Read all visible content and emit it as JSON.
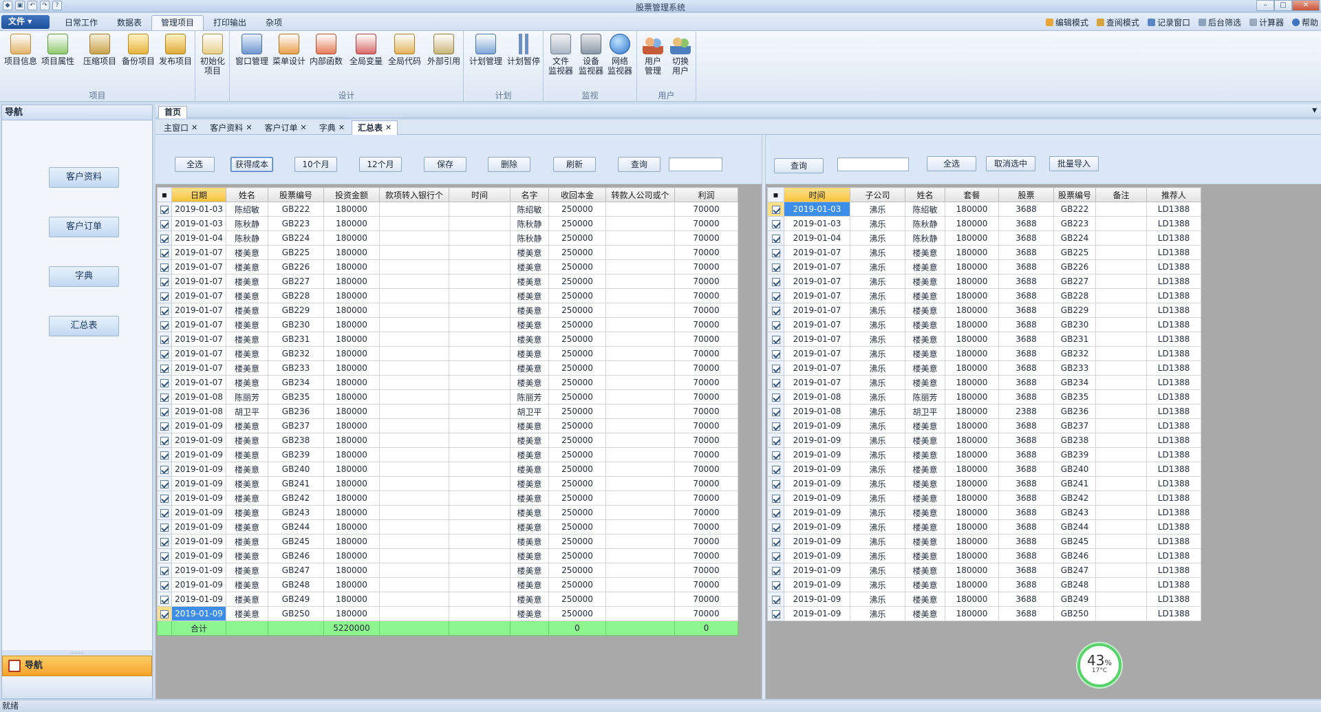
{
  "window": {
    "title": "股票管理系统"
  },
  "menu": {
    "file": "文件",
    "tabs": [
      "日常工作",
      "数据表",
      "管理项目",
      "打印输出",
      "杂项"
    ],
    "right": [
      "编辑模式",
      "查阅模式",
      "记录窗口",
      "后台筛选",
      "计算器",
      "帮助"
    ]
  },
  "ribbon": {
    "groups": [
      {
        "name": "项目",
        "buttons": [
          "项目信息",
          "项目属性",
          "压缩项目",
          "备份项目",
          "发布项目",
          "初始化\n项目"
        ]
      },
      {
        "name": "设计",
        "buttons": [
          "窗口管理",
          "菜单设计",
          "内部函数",
          "全局变量",
          "全局代码",
          "外部引用"
        ]
      },
      {
        "name": "计划",
        "buttons": [
          "计划管理",
          "计划暂停"
        ]
      },
      {
        "name": "监视",
        "buttons": [
          "文件\n监视器",
          "设备\n监视器",
          "网络\n监视器"
        ]
      },
      {
        "name": "用户",
        "buttons": [
          "用户\n管理",
          "切换\n用户"
        ]
      }
    ]
  },
  "nav": {
    "title": "导航",
    "items": [
      "客户资料",
      "客户订单",
      "字典",
      "汇总表"
    ],
    "footer": "导航",
    "grip": "........"
  },
  "doc": {
    "home": "首页",
    "tabs": [
      "主窗口",
      "客户资料",
      "客户订单",
      "字典",
      "汇总表"
    ],
    "active_tab": "汇总表"
  },
  "left_toolbar": {
    "buttons": [
      "全选",
      "获得成本",
      "10个月",
      "12个月",
      "保存",
      "删除",
      "刷新",
      "查询"
    ],
    "search_value": ""
  },
  "right_toolbar": {
    "buttons": [
      "查询",
      "全选",
      "取消选中",
      "批量导入"
    ],
    "search_value": ""
  },
  "left_table": {
    "headers": [
      "日期",
      "姓名",
      "股票编号",
      "投资金额",
      "款项转入银行个",
      "时间",
      "名字",
      "收回本金",
      "转款人公司或个",
      "利润"
    ],
    "rows": [
      [
        "2019-01-03",
        "陈绍敏",
        "GB222",
        "180000",
        "",
        "",
        "陈绍敏",
        "250000",
        "",
        "70000"
      ],
      [
        "2019-01-03",
        "陈秋静",
        "GB223",
        "180000",
        "",
        "",
        "陈秋静",
        "250000",
        "",
        "70000"
      ],
      [
        "2019-01-04",
        "陈秋静",
        "GB224",
        "180000",
        "",
        "",
        "陈秋静",
        "250000",
        "",
        "70000"
      ],
      [
        "2019-01-07",
        "楼美意",
        "GB225",
        "180000",
        "",
        "",
        "楼美意",
        "250000",
        "",
        "70000"
      ],
      [
        "2019-01-07",
        "楼美意",
        "GB226",
        "180000",
        "",
        "",
        "楼美意",
        "250000",
        "",
        "70000"
      ],
      [
        "2019-01-07",
        "楼美意",
        "GB227",
        "180000",
        "",
        "",
        "楼美意",
        "250000",
        "",
        "70000"
      ],
      [
        "2019-01-07",
        "楼美意",
        "GB228",
        "180000",
        "",
        "",
        "楼美意",
        "250000",
        "",
        "70000"
      ],
      [
        "2019-01-07",
        "楼美意",
        "GB229",
        "180000",
        "",
        "",
        "楼美意",
        "250000",
        "",
        "70000"
      ],
      [
        "2019-01-07",
        "楼美意",
        "GB230",
        "180000",
        "",
        "",
        "楼美意",
        "250000",
        "",
        "70000"
      ],
      [
        "2019-01-07",
        "楼美意",
        "GB231",
        "180000",
        "",
        "",
        "楼美意",
        "250000",
        "",
        "70000"
      ],
      [
        "2019-01-07",
        "楼美意",
        "GB232",
        "180000",
        "",
        "",
        "楼美意",
        "250000",
        "",
        "70000"
      ],
      [
        "2019-01-07",
        "楼美意",
        "GB233",
        "180000",
        "",
        "",
        "楼美意",
        "250000",
        "",
        "70000"
      ],
      [
        "2019-01-07",
        "楼美意",
        "GB234",
        "180000",
        "",
        "",
        "楼美意",
        "250000",
        "",
        "70000"
      ],
      [
        "2019-01-08",
        "陈丽芳",
        "GB235",
        "180000",
        "",
        "",
        "陈丽芳",
        "250000",
        "",
        "70000"
      ],
      [
        "2019-01-08",
        "胡卫平",
        "GB236",
        "180000",
        "",
        "",
        "胡卫平",
        "250000",
        "",
        "70000"
      ],
      [
        "2019-01-09",
        "楼美意",
        "GB237",
        "180000",
        "",
        "",
        "楼美意",
        "250000",
        "",
        "70000"
      ],
      [
        "2019-01-09",
        "楼美意",
        "GB238",
        "180000",
        "",
        "",
        "楼美意",
        "250000",
        "",
        "70000"
      ],
      [
        "2019-01-09",
        "楼美意",
        "GB239",
        "180000",
        "",
        "",
        "楼美意",
        "250000",
        "",
        "70000"
      ],
      [
        "2019-01-09",
        "楼美意",
        "GB240",
        "180000",
        "",
        "",
        "楼美意",
        "250000",
        "",
        "70000"
      ],
      [
        "2019-01-09",
        "楼美意",
        "GB241",
        "180000",
        "",
        "",
        "楼美意",
        "250000",
        "",
        "70000"
      ],
      [
        "2019-01-09",
        "楼美意",
        "GB242",
        "180000",
        "",
        "",
        "楼美意",
        "250000",
        "",
        "70000"
      ],
      [
        "2019-01-09",
        "楼美意",
        "GB243",
        "180000",
        "",
        "",
        "楼美意",
        "250000",
        "",
        "70000"
      ],
      [
        "2019-01-09",
        "楼美意",
        "GB244",
        "180000",
        "",
        "",
        "楼美意",
        "250000",
        "",
        "70000"
      ],
      [
        "2019-01-09",
        "楼美意",
        "GB245",
        "180000",
        "",
        "",
        "楼美意",
        "250000",
        "",
        "70000"
      ],
      [
        "2019-01-09",
        "楼美意",
        "GB246",
        "180000",
        "",
        "",
        "楼美意",
        "250000",
        "",
        "70000"
      ],
      [
        "2019-01-09",
        "楼美意",
        "GB247",
        "180000",
        "",
        "",
        "楼美意",
        "250000",
        "",
        "70000"
      ],
      [
        "2019-01-09",
        "楼美意",
        "GB248",
        "180000",
        "",
        "",
        "楼美意",
        "250000",
        "",
        "70000"
      ],
      [
        "2019-01-09",
        "楼美意",
        "GB249",
        "180000",
        "",
        "",
        "楼美意",
        "250000",
        "",
        "70000"
      ],
      [
        "2019-01-09",
        "楼美意",
        "GB250",
        "180000",
        "",
        "",
        "楼美意",
        "250000",
        "",
        "70000"
      ]
    ],
    "total": [
      "合计",
      "",
      "",
      "5220000",
      "",
      "",
      "",
      "0",
      "",
      "0"
    ]
  },
  "right_table": {
    "headers": [
      "时间",
      "子公司",
      "姓名",
      "套餐",
      "股票",
      "股票编号",
      "备注",
      "推荐人"
    ],
    "rows": [
      [
        "2019-01-03",
        "沸乐",
        "陈绍敏",
        "180000",
        "3688",
        "GB222",
        "",
        "LD1388"
      ],
      [
        "2019-01-03",
        "沸乐",
        "陈秋静",
        "180000",
        "3688",
        "GB223",
        "",
        "LD1388"
      ],
      [
        "2019-01-04",
        "沸乐",
        "陈秋静",
        "180000",
        "3688",
        "GB224",
        "",
        "LD1388"
      ],
      [
        "2019-01-07",
        "沸乐",
        "楼美意",
        "180000",
        "3688",
        "GB225",
        "",
        "LD1388"
      ],
      [
        "2019-01-07",
        "沸乐",
        "楼美意",
        "180000",
        "3688",
        "GB226",
        "",
        "LD1388"
      ],
      [
        "2019-01-07",
        "沸乐",
        "楼美意",
        "180000",
        "3688",
        "GB227",
        "",
        "LD1388"
      ],
      [
        "2019-01-07",
        "沸乐",
        "楼美意",
        "180000",
        "3688",
        "GB228",
        "",
        "LD1388"
      ],
      [
        "2019-01-07",
        "沸乐",
        "楼美意",
        "180000",
        "3688",
        "GB229",
        "",
        "LD1388"
      ],
      [
        "2019-01-07",
        "沸乐",
        "楼美意",
        "180000",
        "3688",
        "GB230",
        "",
        "LD1388"
      ],
      [
        "2019-01-07",
        "沸乐",
        "楼美意",
        "180000",
        "3688",
        "GB231",
        "",
        "LD1388"
      ],
      [
        "2019-01-07",
        "沸乐",
        "楼美意",
        "180000",
        "3688",
        "GB232",
        "",
        "LD1388"
      ],
      [
        "2019-01-07",
        "沸乐",
        "楼美意",
        "180000",
        "3688",
        "GB233",
        "",
        "LD1388"
      ],
      [
        "2019-01-07",
        "沸乐",
        "楼美意",
        "180000",
        "3688",
        "GB234",
        "",
        "LD1388"
      ],
      [
        "2019-01-08",
        "沸乐",
        "陈丽芳",
        "180000",
        "3688",
        "GB235",
        "",
        "LD1388"
      ],
      [
        "2019-01-08",
        "沸乐",
        "胡卫平",
        "180000",
        "2388",
        "GB236",
        "",
        "LD1388"
      ],
      [
        "2019-01-09",
        "沸乐",
        "楼美意",
        "180000",
        "3688",
        "GB237",
        "",
        "LD1388"
      ],
      [
        "2019-01-09",
        "沸乐",
        "楼美意",
        "180000",
        "3688",
        "GB238",
        "",
        "LD1388"
      ],
      [
        "2019-01-09",
        "沸乐",
        "楼美意",
        "180000",
        "3688",
        "GB239",
        "",
        "LD1388"
      ],
      [
        "2019-01-09",
        "沸乐",
        "楼美意",
        "180000",
        "3688",
        "GB240",
        "",
        "LD1388"
      ],
      [
        "2019-01-09",
        "沸乐",
        "楼美意",
        "180000",
        "3688",
        "GB241",
        "",
        "LD1388"
      ],
      [
        "2019-01-09",
        "沸乐",
        "楼美意",
        "180000",
        "3688",
        "GB242",
        "",
        "LD1388"
      ],
      [
        "2019-01-09",
        "沸乐",
        "楼美意",
        "180000",
        "3688",
        "GB243",
        "",
        "LD1388"
      ],
      [
        "2019-01-09",
        "沸乐",
        "楼美意",
        "180000",
        "3688",
        "GB244",
        "",
        "LD1388"
      ],
      [
        "2019-01-09",
        "沸乐",
        "楼美意",
        "180000",
        "3688",
        "GB245",
        "",
        "LD1388"
      ],
      [
        "2019-01-09",
        "沸乐",
        "楼美意",
        "180000",
        "3688",
        "GB246",
        "",
        "LD1388"
      ],
      [
        "2019-01-09",
        "沸乐",
        "楼美意",
        "180000",
        "3688",
        "GB247",
        "",
        "LD1388"
      ],
      [
        "2019-01-09",
        "沸乐",
        "楼美意",
        "180000",
        "3688",
        "GB248",
        "",
        "LD1388"
      ],
      [
        "2019-01-09",
        "沸乐",
        "楼美意",
        "180000",
        "3688",
        "GB249",
        "",
        "LD1388"
      ],
      [
        "2019-01-09",
        "沸乐",
        "楼美意",
        "180000",
        "3688",
        "GB250",
        "",
        "LD1388"
      ]
    ]
  },
  "widget": {
    "percent": "43",
    "unit": "%",
    "temp": "17°C"
  },
  "status": {
    "text": "就绪"
  }
}
